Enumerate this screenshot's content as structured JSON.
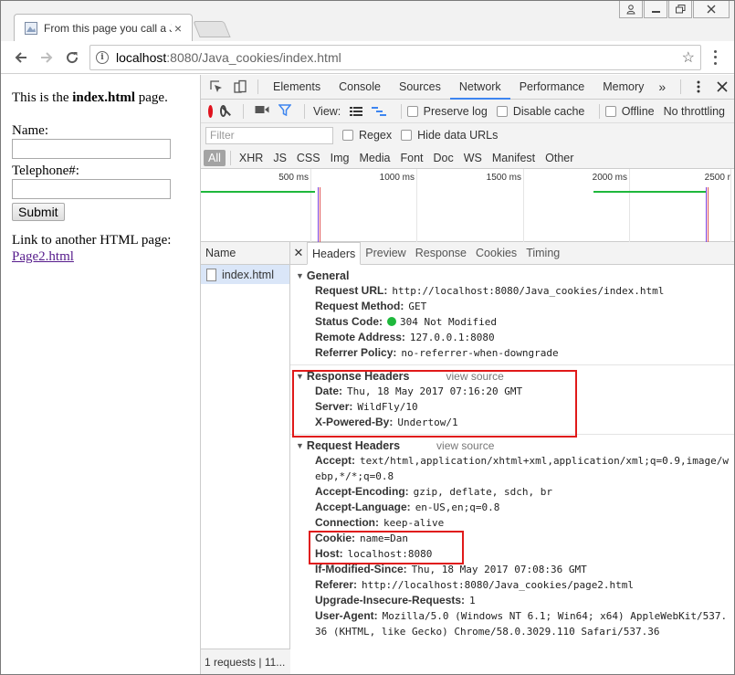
{
  "browser": {
    "tab_title": "From this page you call a Ja",
    "url_host": "localhost",
    "url_rest": ":8080/Java_cookies/index.html"
  },
  "page": {
    "intro_prefix": "This is the ",
    "intro_bold": "index.html",
    "intro_suffix": " page.",
    "name_label": "Name:",
    "phone_label": "Telephone#:",
    "submit_label": "Submit",
    "link_intro": "Link to another HTML page:",
    "link_text": "Page2.html"
  },
  "devtools": {
    "tabs": [
      "Elements",
      "Console",
      "Sources",
      "Network",
      "Performance",
      "Memory"
    ],
    "active_tab": "Network",
    "more_tabs": "»",
    "toolbar": {
      "view_label": "View:",
      "preserve_log": "Preserve log",
      "disable_cache": "Disable cache",
      "offline": "Offline",
      "throttling": "No throttling"
    },
    "filter": {
      "placeholder": "Filter",
      "regex": "Regex",
      "hide_data_urls": "Hide data URLs"
    },
    "types": [
      "All",
      "XHR",
      "JS",
      "CSS",
      "Img",
      "Media",
      "Font",
      "Doc",
      "WS",
      "Manifest",
      "Other"
    ],
    "overview_ticks": [
      "500 ms",
      "1000 ms",
      "1500 ms",
      "2000 ms",
      "2500 r"
    ],
    "requests": {
      "column_name": "Name",
      "items": [
        "index.html"
      ],
      "footer": "1 requests | 11..."
    },
    "detail": {
      "tabs": [
        "Headers",
        "Preview",
        "Response",
        "Cookies",
        "Timing"
      ],
      "active_tab": "Headers",
      "view_source": "view source",
      "general": {
        "title": "General",
        "request_url_k": "Request URL:",
        "request_url_v": "http://localhost:8080/Java_cookies/index.html",
        "method_k": "Request Method:",
        "method_v": "GET",
        "status_k": "Status Code:",
        "status_v": "304 Not Modified",
        "remote_k": "Remote Address:",
        "remote_v": "127.0.0.1:8080",
        "referrer_policy_k": "Referrer Policy:",
        "referrer_policy_v": "no-referrer-when-downgrade"
      },
      "response_headers": {
        "title": "Response Headers",
        "date_k": "Date:",
        "date_v": "Thu, 18 May 2017 07:16:20 GMT",
        "server_k": "Server:",
        "server_v": "WildFly/10",
        "powered_k": "X-Powered-By:",
        "powered_v": "Undertow/1"
      },
      "request_headers": {
        "title": "Request Headers",
        "accept_k": "Accept:",
        "accept_v": "text/html,application/xhtml+xml,application/xml;q=0.9,image/webp,*/*;q=0.8",
        "encoding_k": "Accept-Encoding:",
        "encoding_v": "gzip, deflate, sdch, br",
        "language_k": "Accept-Language:",
        "language_v": "en-US,en;q=0.8",
        "connection_k": "Connection:",
        "connection_v": "keep-alive",
        "cookie_k": "Cookie:",
        "cookie_v": "name=Dan",
        "host_k": "Host:",
        "host_v": "localhost:8080",
        "ims_k": "If-Modified-Since:",
        "ims_v": "Thu, 18 May 2017 07:08:36 GMT",
        "referer_k": "Referer:",
        "referer_v": "http://localhost:8080/Java_cookies/page2.html",
        "upgrade_k": "Upgrade-Insecure-Requests:",
        "upgrade_v": "1",
        "ua_k": "User-Agent:",
        "ua_v": "Mozilla/5.0 (Windows NT 6.1; Win64; x64) AppleWebKit/537.36 (KHTML, like Gecko) Chrome/58.0.3029.110 Safari/537.36"
      }
    }
  },
  "colors": {
    "record": "#e0131e",
    "active_tab_underline": "#3d85f0",
    "highlight_box": "#e01a1a",
    "status_ok": "#1eb83c",
    "selected_row": "#dae6f8"
  }
}
